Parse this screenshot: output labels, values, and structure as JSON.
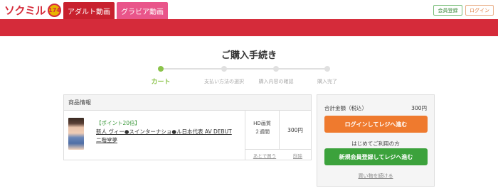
{
  "header": {
    "logo_text": "ソクミル",
    "logo_badge": "174",
    "tabs": [
      {
        "label": "アダルト動画"
      },
      {
        "label": "グラビア動画"
      }
    ],
    "register_label": "会員登録",
    "login_label": "ログイン"
  },
  "page_title": "ご購入手続き",
  "steps": [
    {
      "label": "カート",
      "active": true
    },
    {
      "label": "支払い方法の選択",
      "active": false
    },
    {
      "label": "購入内容の確認",
      "active": false
    },
    {
      "label": "購入完了",
      "active": false
    }
  ],
  "product_table": {
    "header": "商品情報",
    "item": {
      "point_badge": "【ポイント20倍】",
      "title": "新人 ヴィー●スインターナショ●ル日本代表 AV DEBUT 二階堂夢",
      "quality": "HD画質",
      "period": "２週間",
      "price": "300円",
      "later_link": "あとで買う",
      "delete_link": "削除"
    }
  },
  "summary": {
    "total_label": "合計金額（税込）",
    "total_value": "300円",
    "login_button": "ログインしてレジへ進む",
    "first_time_text": "はじめてご利用の方",
    "register_button": "新規会員登録してレジへ進む",
    "continue_link": "買い物を続ける"
  },
  "colors": {
    "brand_red": "#d52b3a",
    "gravure_pink": "#e9558a",
    "step_active": "#8bc34a",
    "login_orange": "#ef7a2e",
    "register_green": "#3ca23c"
  }
}
